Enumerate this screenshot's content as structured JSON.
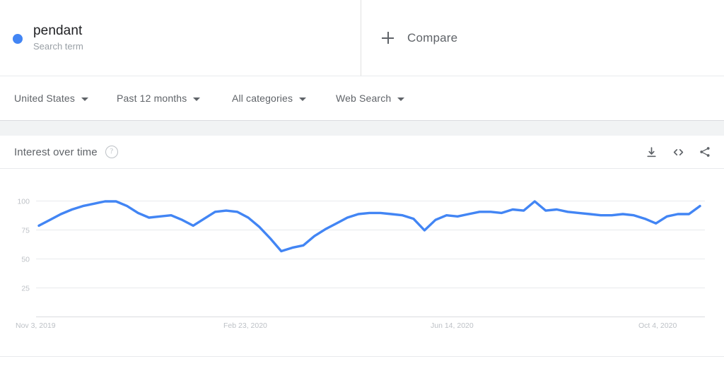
{
  "terms": [
    {
      "label": "pendant",
      "sublabel": "Search term",
      "color": "#4285f4"
    }
  ],
  "compare": {
    "label": "Compare",
    "icon": "plus-icon"
  },
  "filters": [
    {
      "name": "location",
      "value": "United States"
    },
    {
      "name": "time-range",
      "value": "Past 12 months"
    },
    {
      "name": "category",
      "value": "All categories"
    },
    {
      "name": "search-type",
      "value": "Web Search"
    }
  ],
  "card": {
    "title": "Interest over time",
    "help_icon": "?",
    "actions": [
      {
        "name": "download",
        "icon": "download-icon"
      },
      {
        "name": "embed",
        "icon": "embed-code-icon"
      },
      {
        "name": "share",
        "icon": "share-icon"
      }
    ]
  },
  "chart_data": {
    "type": "line",
    "title": "Interest over time",
    "xlabel": "",
    "ylabel": "",
    "ylim": [
      0,
      100
    ],
    "yticks": [
      25,
      50,
      75,
      100
    ],
    "grid": true,
    "legend": "none",
    "line_color": "#4285f4",
    "xticks": [
      "Nov 3, 2019",
      "Feb 23, 2020",
      "Jun 14, 2020",
      "Oct 4, 2020"
    ],
    "xtick_positions": [
      0,
      16,
      32,
      48
    ],
    "series": [
      {
        "name": "pendant",
        "color": "#4285f4",
        "values": [
          79,
          84,
          89,
          93,
          96,
          98,
          100,
          100,
          96,
          90,
          86,
          87,
          88,
          84,
          79,
          85,
          91,
          92,
          91,
          86,
          78,
          68,
          57,
          60,
          62,
          70,
          76,
          81,
          86,
          89,
          90,
          90,
          89,
          88,
          85,
          75,
          84,
          88,
          87,
          89,
          91,
          91,
          90,
          93,
          92,
          100,
          92,
          93,
          91,
          90,
          89,
          88,
          88,
          89,
          88,
          85,
          81,
          87,
          89,
          89,
          96
        ]
      }
    ]
  }
}
